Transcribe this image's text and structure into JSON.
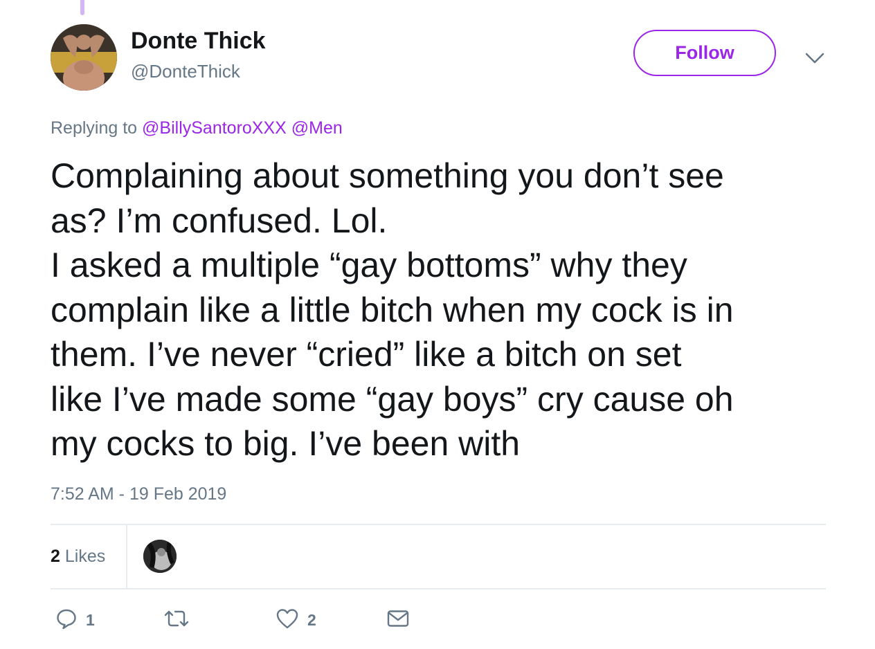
{
  "user": {
    "display_name": "Donte Thick",
    "handle": "@DonteThick"
  },
  "follow_label": "Follow",
  "reply_context": {
    "prefix": "Replying to",
    "mentions": [
      "@BillySantoroXXX",
      "@Men"
    ]
  },
  "tweet": {
    "lines": [
      "Complaining about something you don’t see",
      "as? I’m confused. Lol.",
      "I asked a multiple “gay bottoms” why they",
      "complain like a little bitch when my cock is in",
      "them. I’ve never “cried” like a bitch on set",
      "like I’ve made some “gay boys” cry cause oh",
      "my cocks to big. I’ve been with"
    ],
    "timestamp": "7:52 AM - 19 Feb 2019"
  },
  "stats": {
    "likes_count": "2",
    "likes_label": "Likes"
  },
  "actions": {
    "reply_count": "1",
    "like_count": "2"
  },
  "colors": {
    "accent": "#9b26e8",
    "muted": "#657786",
    "text": "#14171a",
    "divider": "#e6ecf0"
  }
}
